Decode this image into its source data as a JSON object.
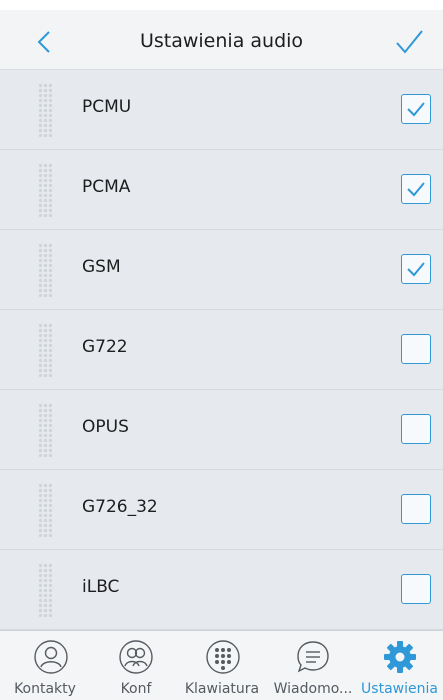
{
  "header": {
    "title": "Ustawienia audio",
    "back_icon": "chevron-left-icon",
    "done_icon": "checkmark-icon"
  },
  "codecs": [
    {
      "name": "PCMU",
      "checked": true
    },
    {
      "name": "PCMA",
      "checked": true
    },
    {
      "name": "GSM",
      "checked": true
    },
    {
      "name": "G722",
      "checked": false
    },
    {
      "name": "OPUS",
      "checked": false
    },
    {
      "name": "G726_32",
      "checked": false
    },
    {
      "name": "iLBC",
      "checked": false
    }
  ],
  "tabs": [
    {
      "label": "Kontakty",
      "icon": "contacts-icon",
      "active": false
    },
    {
      "label": "Konf",
      "icon": "conference-icon",
      "active": false
    },
    {
      "label": "Klawiatura",
      "icon": "keypad-icon",
      "active": false
    },
    {
      "label": "Wiadomo...",
      "icon": "messages-icon",
      "active": false
    },
    {
      "label": "Ustawienia",
      "icon": "settings-gear-icon",
      "active": true
    }
  ],
  "colors": {
    "accent": "#2f98d8",
    "background": "#e6eaee",
    "tab_inactive": "#555b61"
  }
}
